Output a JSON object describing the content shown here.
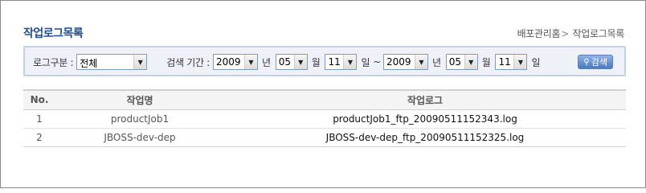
{
  "page": {
    "title": "작업로그목록"
  },
  "breadcrumb": {
    "home": "배포관리홈",
    "separator": ">",
    "current": "작업로그목록"
  },
  "search": {
    "category_label": "로그구분 :",
    "category_value": "전체",
    "period_label": "검색 기간 :",
    "from": {
      "year": "2009",
      "month": "05",
      "day": "11"
    },
    "to": {
      "year": "2009",
      "month": "05",
      "day": "11"
    },
    "year_unit": "년",
    "month_unit": "월",
    "day_unit": "일",
    "range_sep": "~",
    "button_label": "검색"
  },
  "table": {
    "headers": {
      "no": "No.",
      "job": "작업명",
      "log": "작업로그"
    },
    "rows": [
      {
        "no": "1",
        "job": "productJob1",
        "log": "productJob1_ftp_20090511152343.log"
      },
      {
        "no": "2",
        "job": "JBOSS-dev-dep",
        "log": "JBOSS-dev-dep_ftp_20090511152325.log"
      }
    ]
  }
}
